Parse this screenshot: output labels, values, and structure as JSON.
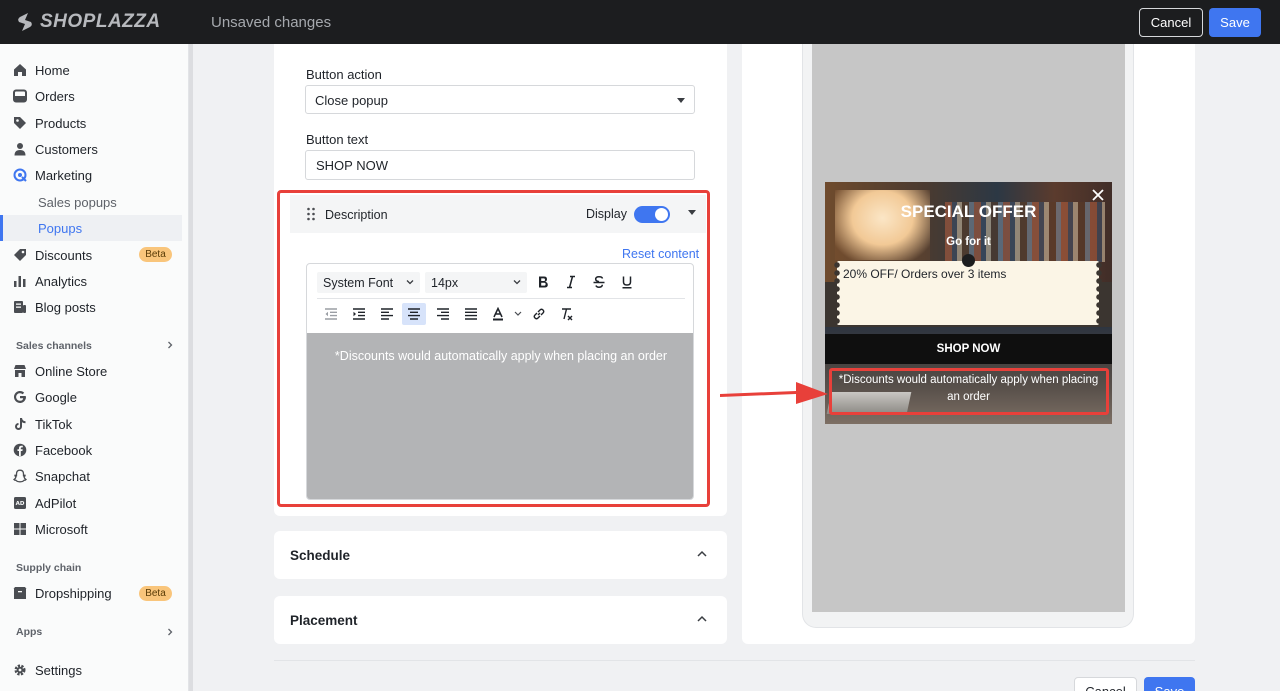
{
  "topbar": {
    "logo": "SHOPLAZZA",
    "status": "Unsaved changes",
    "cancel_label": "Cancel",
    "save_label": "Save"
  },
  "sidebar": {
    "items": [
      {
        "label": "Home",
        "icon": "home-icon"
      },
      {
        "label": "Orders",
        "icon": "orders-icon"
      },
      {
        "label": "Products",
        "icon": "tag-icon"
      },
      {
        "label": "Customers",
        "icon": "person-icon"
      },
      {
        "label": "Marketing",
        "icon": "target-icon"
      }
    ],
    "marketing_sub": [
      "Sales popups",
      "Popups"
    ],
    "discounts": {
      "label": "Discounts",
      "badge": "Beta"
    },
    "analytics": "Analytics",
    "blog": "Blog posts",
    "sales_channels_head": "Sales channels",
    "channels": [
      "Online Store",
      "Google",
      "TikTok",
      "Facebook",
      "Snapchat",
      "AdPilot",
      "Microsoft"
    ],
    "supply_head": "Supply chain",
    "dropshipping": {
      "label": "Dropshipping",
      "badge": "Beta"
    },
    "apps_head": "Apps",
    "settings": "Settings",
    "accent": "#3f76f0"
  },
  "form": {
    "button_action_label": "Button action",
    "button_action_value": "Close popup",
    "button_text_label": "Button text",
    "button_text_value": "SHOP NOW"
  },
  "description": {
    "title": "Description",
    "display_label": "Display",
    "display_on": true,
    "reset_label": "Reset content",
    "font_family": "System Font",
    "font_size": "14px",
    "content": "*Discounts would automatically apply when placing an order"
  },
  "sections": {
    "schedule": "Schedule",
    "placement": "Placement"
  },
  "footer": {
    "cancel_label": "Cancel",
    "save_label": "Save"
  },
  "preview": {
    "headline": "SPECIAL OFFER",
    "subhead": "Go for it",
    "coupon": "20% OFF/ Orders over 3 items",
    "button": "SHOP NOW",
    "description": "*Discounts would automatically apply when placing an order"
  },
  "annotation": {
    "color": "#e8403a"
  }
}
